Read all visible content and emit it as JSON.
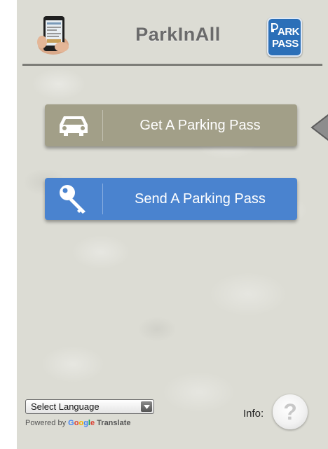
{
  "header": {
    "title": "ParkInAll",
    "logo_line1": "ARK",
    "logo_line2": "PASS"
  },
  "actions": {
    "get_pass_label": "Get A Parking Pass",
    "send_pass_label": "Send A Parking Pass"
  },
  "footer": {
    "language_selected": "Select Language",
    "powered_by": "Powered by",
    "google_letters": [
      "G",
      "o",
      "o",
      "g",
      "l",
      "e"
    ],
    "translate": "Translate",
    "info_label": "Info:",
    "info_symbol": "?"
  },
  "colors": {
    "get_button": "#a29f88",
    "send_button": "#4a83cf",
    "logo_blue": "#2b6fb8"
  },
  "icons": [
    "phone-logo-icon",
    "car-icon",
    "key-icon",
    "arrow-left-icon",
    "chevron-down-icon",
    "question-icon"
  ]
}
